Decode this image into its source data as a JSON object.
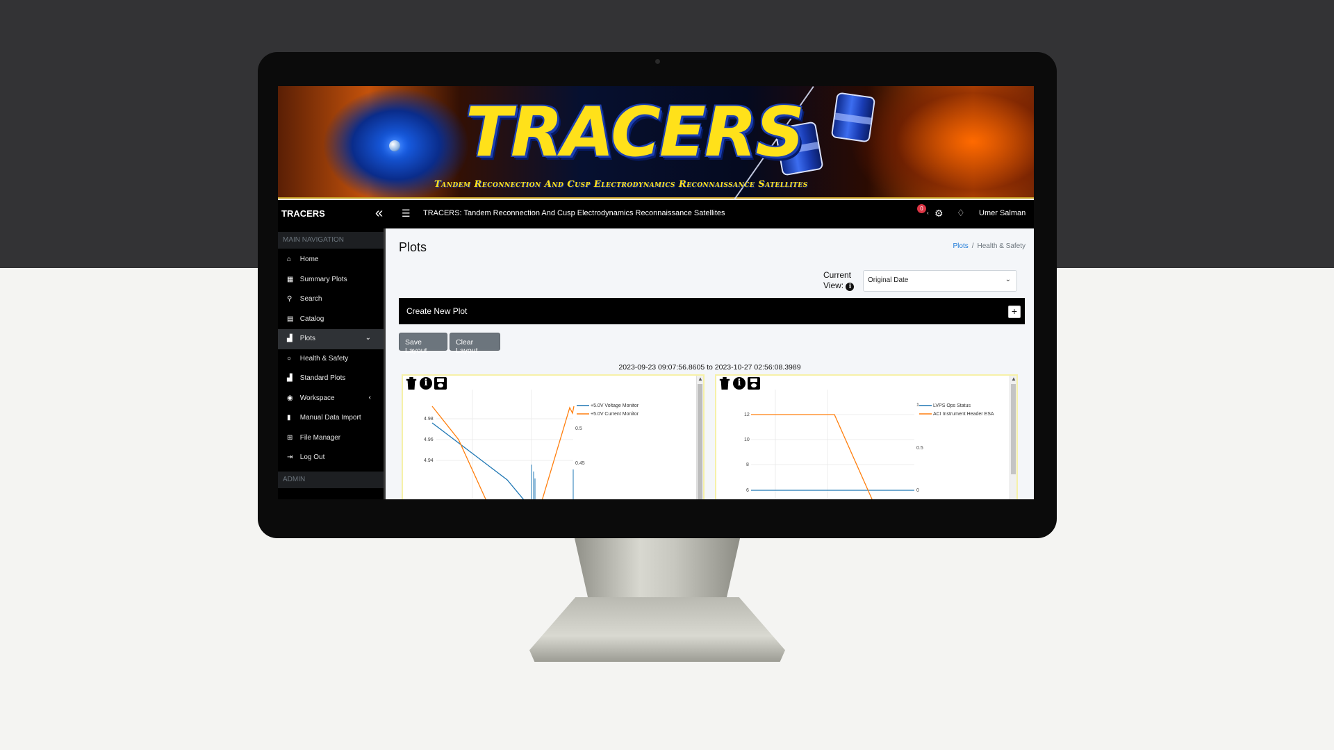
{
  "banner": {
    "title": "TRACERS",
    "subtitle": "Tandem Reconnection And Cusp Electrodynamics Reconnaissance Satellites"
  },
  "navbar": {
    "brand": "TRACERS",
    "collapse_icon": "«",
    "menu_icon": "☰",
    "title": "TRACERS: Tandem Reconnection And Cusp Electrodynamics Reconnaissance Satellites",
    "notification_count": "0",
    "settings_icon": "⚙",
    "bell_icon": "🔔",
    "username": "Umer Salman"
  },
  "sidebar": {
    "main_header": "MAIN NAVIGATION",
    "items": [
      {
        "label": "Home",
        "icon": "⌂"
      },
      {
        "label": "Summary Plots",
        "icon": "▦"
      },
      {
        "label": "Search",
        "icon": "⚲"
      },
      {
        "label": "Catalog",
        "icon": "▤"
      },
      {
        "label": "Plots",
        "icon": "▟",
        "caret": "⌄"
      },
      {
        "label": "Health & Safety",
        "icon": "○"
      },
      {
        "label": "Standard Plots",
        "icon": "▟"
      },
      {
        "label": "Workspace",
        "icon": "◉",
        "caret": "‹"
      },
      {
        "label": "Manual Data Import",
        "icon": "▮"
      },
      {
        "label": "File Manager",
        "icon": "⊞"
      },
      {
        "label": "Log Out",
        "icon": "⇥"
      }
    ],
    "admin_header": "ADMIN"
  },
  "content": {
    "page_title": "Plots",
    "breadcrumb": {
      "link": "Plots",
      "separator": "/",
      "current": "Health & Safety"
    },
    "current_view_label": "Current View:",
    "current_view_value": "Original Date",
    "create_new_plot": "Create New Plot",
    "plus_label": "+",
    "save_layout": "Save Layout",
    "clear_layout": "Clear Layout",
    "date_range": "2023-09-23 09:07:56.8605 to 2023-10-27 02:56:08.3989"
  },
  "plots": [
    {
      "legend": [
        "+5.0V Voltage Monitor",
        "+5.0V Current Monitor"
      ],
      "left_ticks": [
        "4.98",
        "4.96",
        "4.94"
      ],
      "right_ticks": [
        "0.5",
        "0.45"
      ]
    },
    {
      "legend": [
        "LVPS Ops Status",
        "ACI Instrument Header ESA"
      ],
      "left_ticks": [
        "12",
        "10",
        "8",
        "6"
      ],
      "right_ticks": [
        "1",
        "0.5",
        "0"
      ]
    }
  ],
  "colors": {
    "series_blue": "#1f77b4",
    "series_orange": "#ff7f0e",
    "badge_red": "#dc3545",
    "breadcrumb_link": "#1e7ad8"
  }
}
